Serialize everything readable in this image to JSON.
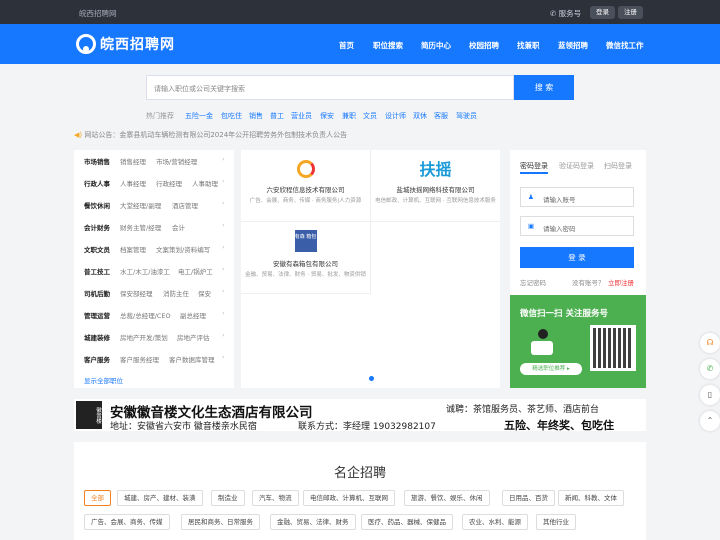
{
  "topbar": {
    "site": "皖西招聘网",
    "service": "服务号",
    "login": "登录",
    "register": "注册"
  },
  "header": {
    "logo": "皖西招聘网",
    "nav": [
      "首页",
      "职位搜索",
      "简历中心",
      "校园招聘",
      "找兼职",
      "蓝领招聘",
      "微信找工作"
    ]
  },
  "search": {
    "placeholder": "请输入职位或公司关键字搜索",
    "button": "搜 索"
  },
  "hot": {
    "label": "热门推荐",
    "words": [
      "五险一金",
      "包吃住",
      "销售",
      "普工",
      "营业员",
      "保安",
      "兼职",
      "文员",
      "设计师",
      "双休",
      "客服",
      "驾驶员"
    ]
  },
  "notice": {
    "text": "网站公告：金寨县机动车辆检测有限公司2024年公开招聘劳务外包制技术负责人公告"
  },
  "categories": [
    {
      "title": "市场销售",
      "subs": [
        "销售经理",
        "市场/营销经理"
      ]
    },
    {
      "title": "行政人事",
      "subs": [
        "人事经理",
        "行政经理",
        "人事助理"
      ]
    },
    {
      "title": "餐饮休闲",
      "subs": [
        "大堂经理/副理",
        "酒店管理"
      ]
    },
    {
      "title": "会计财务",
      "subs": [
        "财务主管/经理",
        "会计"
      ]
    },
    {
      "title": "文职文员",
      "subs": [
        "档案管理",
        "文案策划/资料编写"
      ]
    },
    {
      "title": "普工技工",
      "subs": [
        "水工/木工/油漆工",
        "电工/锅炉工"
      ]
    },
    {
      "title": "司机后勤",
      "subs": [
        "保安部经理",
        "消防主任",
        "保安"
      ]
    },
    {
      "title": "管理运营",
      "subs": [
        "总裁/总经理/CEO",
        "副总经理"
      ]
    },
    {
      "title": "城建装修",
      "subs": [
        "房地产开发/策划",
        "房地产评估"
      ]
    },
    {
      "title": "客户服务",
      "subs": [
        "客户服务经理",
        "客户数据库管理"
      ]
    }
  ],
  "all_jobs": "显示全部职位",
  "companies": [
    {
      "name": "六安欣程信息技术有限公司",
      "desc": "广告、会展、商务、传媒 · 商务服务|人力资源"
    },
    {
      "name": "盐城扶摇网络科技有限公司",
      "logo": "扶摇",
      "desc": "电信邮政、计算机、互联网 · 互联网信息技术服务"
    },
    {
      "name": "安徽有森箱包有限公司",
      "logo": "有森 箱包",
      "desc": "金融、贸易、法律、财务 · 贸易、批发、物资供销"
    }
  ],
  "login": {
    "tabs": [
      "密码登录",
      "验证码登录",
      "扫码登录"
    ],
    "account": "请输入账号",
    "password": "请输入密码",
    "button": "登 录",
    "forgot": "忘记密码",
    "noaccount": "没有账号？",
    "register": "立即注册",
    "wechat_title": "微信扫一扫 关注服务号",
    "wechat_btn": "精选职位推荐 ▸"
  },
  "banner": {
    "company": "安徽徽音楼文化生态酒店有限公司",
    "address": "地址：安徽省六安市 徽音楼亲水民宿",
    "contact": "联系方式：李经理 19032982107",
    "recruit": "诚聘：茶馆服务员、茶艺师、酒店前台",
    "benefit": "五险、年终奖、包吃住",
    "seal": "徽音楼"
  },
  "mq": {
    "title": "名企招聘",
    "tags": [
      "全部",
      "城建、房产、建材、装潢",
      "制造业",
      "汽车、物流",
      "电信邮政、计算机、互联网",
      "旅游、餐饮、娱乐、休闲",
      "日用品、百货",
      "新闻、科教、文体",
      "广告、会展、商务、传媒",
      "居民和商务、日常服务",
      "金融、贸易、法律、财务",
      "医疗、药品、器械、保健品",
      "农业、水利、能源",
      "其他行业"
    ]
  },
  "colors": {
    "primary": "#1677ff",
    "topbar": "#2c313a",
    "active": "#f58220"
  }
}
